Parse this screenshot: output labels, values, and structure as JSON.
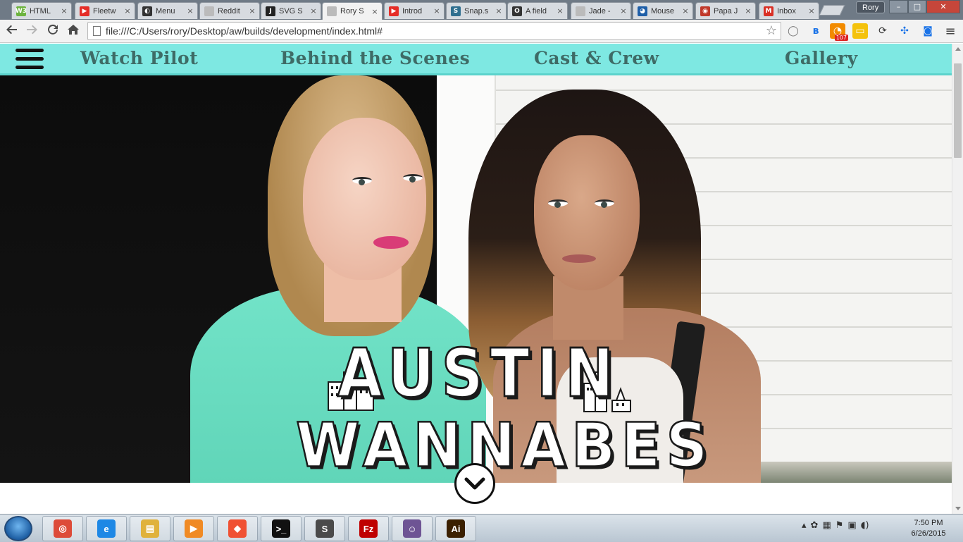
{
  "browser": {
    "tabs": [
      {
        "title": "HTML",
        "favicon_color": "#6db33f",
        "favicon_text": "W3"
      },
      {
        "title": "Fleetw",
        "favicon_color": "#e52d27",
        "favicon_text": "▶"
      },
      {
        "title": "Menu",
        "favicon_color": "#333333",
        "favicon_text": "◐"
      },
      {
        "title": "Reddit",
        "favicon_color": "#bbbbbb",
        "favicon_text": ""
      },
      {
        "title": "SVG S",
        "favicon_color": "#222222",
        "favicon_text": "J"
      },
      {
        "title": "Rory S",
        "favicon_color": "#bbbbbb",
        "favicon_text": "",
        "active": true
      },
      {
        "title": "Introd",
        "favicon_color": "#e52d27",
        "favicon_text": "▶"
      },
      {
        "title": "Snap.s",
        "favicon_color": "#2f6f8f",
        "favicon_text": "S"
      },
      {
        "title": "A field",
        "favicon_color": "#333333",
        "favicon_text": "O"
      },
      {
        "title": "Jade -",
        "favicon_color": "#bbbbbb",
        "favicon_text": ""
      },
      {
        "title": "Mouse",
        "favicon_color": "#1f5fa8",
        "favicon_text": "◕"
      },
      {
        "title": "Papa J",
        "favicon_color": "#c0392b",
        "favicon_text": "◉"
      },
      {
        "title": "Inbox",
        "favicon_color": "#d93025",
        "favicon_text": "M"
      }
    ],
    "tab_close": "×",
    "user_name": "Rory",
    "window_controls": {
      "minimize": "–",
      "maximize": "□",
      "close": "✕"
    },
    "url": "file:///C:/Users/rory/Desktop/aw/builds/development/index.html#",
    "extension_badge": "107"
  },
  "site": {
    "nav": {
      "links": [
        "Watch Pilot",
        "Behind the Scenes",
        "Cast & Crew",
        "Gallery"
      ]
    },
    "logo": {
      "line1": "AUSTIN",
      "line2": "WANNABES"
    }
  },
  "taskbar": {
    "apps": [
      {
        "name": "chrome",
        "color": "#dd4b39",
        "glyph": "◎"
      },
      {
        "name": "internet-explorer",
        "color": "#1e88e5",
        "glyph": "e"
      },
      {
        "name": "file-explorer",
        "color": "#e0b23c",
        "glyph": "▤"
      },
      {
        "name": "media-player",
        "color": "#f08a24",
        "glyph": "▶"
      },
      {
        "name": "git",
        "color": "#f05133",
        "glyph": "◆"
      },
      {
        "name": "command-prompt",
        "color": "#111111",
        "glyph": ">_"
      },
      {
        "name": "sublime-text",
        "color": "#4a4a4a",
        "glyph": "S"
      },
      {
        "name": "filezilla",
        "color": "#bf0000",
        "glyph": "Fz"
      },
      {
        "name": "github",
        "color": "#6e5494",
        "glyph": "☺"
      },
      {
        "name": "illustrator",
        "color": "#3b2000",
        "glyph": "Ai"
      }
    ],
    "time": "7:50 PM",
    "date": "6/26/2015"
  },
  "colors": {
    "nav_bg": "#7ee8e2",
    "nav_text": "#3e6b66",
    "shirt": "#72e3c8"
  }
}
